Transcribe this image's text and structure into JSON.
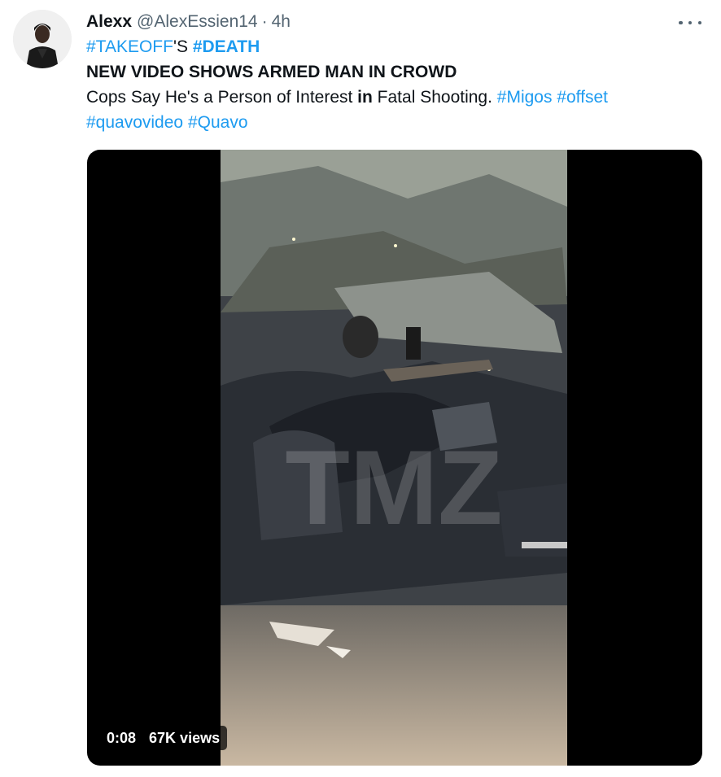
{
  "tweet": {
    "display_name": "Alexx",
    "handle": "@AlexEssien14",
    "separator": "·",
    "time": "4h",
    "line1": {
      "tag_takeoff": "#TAKEOFF",
      "suffix": "'S ",
      "tag_death": "#DEATH"
    },
    "line2": "NEW VIDEO SHOWS ARMED MAN IN CROWD",
    "line3": {
      "text_a": "Cops Say He's a Person of Interest ",
      "bold_in": "in",
      "text_b": " Fatal Shooting. ",
      "tag_migos": "#Migos",
      "tag_offset": "#offset"
    },
    "line4": {
      "tag_quavovideo": "#quavovideo",
      "tag_quavo": "#Quavo"
    }
  },
  "video": {
    "duration": "0:08",
    "views": "67K views",
    "watermark": "TMZ"
  },
  "icons": {
    "more": "more-horizontal-icon",
    "play": "video-player"
  },
  "colors": {
    "link": "#1d9bf0",
    "secondary_text": "#536471",
    "primary_text": "#0f1419"
  }
}
